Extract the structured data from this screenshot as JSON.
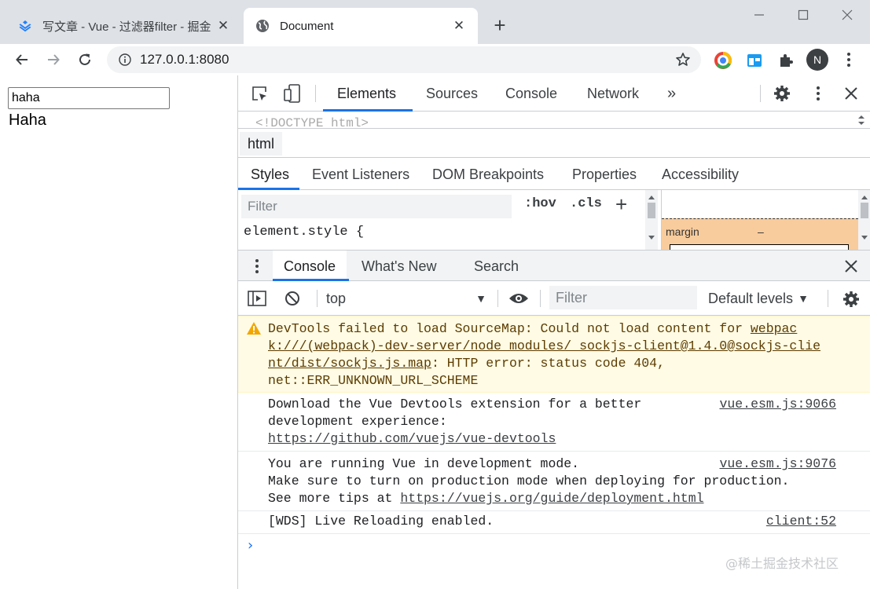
{
  "browser": {
    "tabs": [
      {
        "title": "写文章 - Vue - 过滤器filter - 掘金",
        "favicon": "juejin-logo-icon",
        "active": false
      },
      {
        "title": "Document",
        "favicon": "globe-icon",
        "active": true
      }
    ],
    "new_tab_label": "+",
    "address": "127.0.0.1:8080",
    "profile_initial": "N"
  },
  "page": {
    "input_value": "haha",
    "output_text": "Haha"
  },
  "devtools": {
    "tabs": [
      "Elements",
      "Sources",
      "Console",
      "Network"
    ],
    "more_tabs": "»",
    "doctype": "<!DOCTYPE html>",
    "breadcrumb": "html",
    "style_tabs": [
      "Styles",
      "Event Listeners",
      "DOM Breakpoints",
      "Properties",
      "Accessibility"
    ],
    "styles_filter_placeholder": "Filter",
    "hov": ":hov",
    "cls": ".cls",
    "add_rule": "+",
    "element_style": "element.style {",
    "boxmodel": {
      "margin_label": "margin",
      "margin_value": "–"
    },
    "drawer_tabs": [
      "Console",
      "What's New",
      "Search"
    ],
    "console": {
      "context": "top",
      "filter_placeholder": "Filter",
      "levels": "Default levels",
      "messages": [
        {
          "type": "warning",
          "lines": [
            {
              "parts": [
                {
                  "text": "DevTools failed to load SourceMap: Could not load content for "
                },
                {
                  "text": "webpac",
                  "link": true
                }
              ]
            },
            {
              "parts": [
                {
                  "text": "k:///(webpack)-dev-server/node_modules/_sockjs-client@1.4.0@sockjs-clie",
                  "link": true
                }
              ]
            },
            {
              "parts": [
                {
                  "text": "nt/dist/sockjs.js.map",
                  "link": true
                },
                {
                  "text": ": HTTP error: status code 404,"
                }
              ]
            },
            {
              "parts": [
                {
                  "text": "net::ERR_UNKNOWN_URL_SCHEME"
                }
              ]
            }
          ]
        },
        {
          "type": "log",
          "source": "vue.esm.js:9066",
          "lines": [
            {
              "parts": [
                {
                  "text": "Download the Vue Devtools extension for a better"
                }
              ]
            },
            {
              "parts": [
                {
                  "text": "development experience:"
                }
              ]
            },
            {
              "parts": [
                {
                  "text": "https://github.com/vuejs/vue-devtools",
                  "link": true
                }
              ]
            }
          ]
        },
        {
          "type": "log",
          "source": "vue.esm.js:9076",
          "lines": [
            {
              "parts": [
                {
                  "text": "You are running Vue in development mode."
                }
              ]
            },
            {
              "parts": [
                {
                  "text": "Make sure to turn on production mode when deploying for production."
                }
              ]
            },
            {
              "parts": [
                {
                  "text": "See more tips at "
                },
                {
                  "text": "https://vuejs.org/guide/deployment.html",
                  "link": true
                }
              ]
            }
          ]
        },
        {
          "type": "log",
          "source": "client:52",
          "lines": [
            {
              "parts": [
                {
                  "text": "[WDS] Live Reloading enabled."
                }
              ]
            }
          ]
        }
      ],
      "prompt": "›"
    }
  },
  "watermark": "@稀土掘金技术社区",
  "colors": {
    "accent": "#1a73e8",
    "warning_bg": "#fffbe5",
    "warning_text": "#5c3c00",
    "tabstrip": "#dee1e6"
  }
}
